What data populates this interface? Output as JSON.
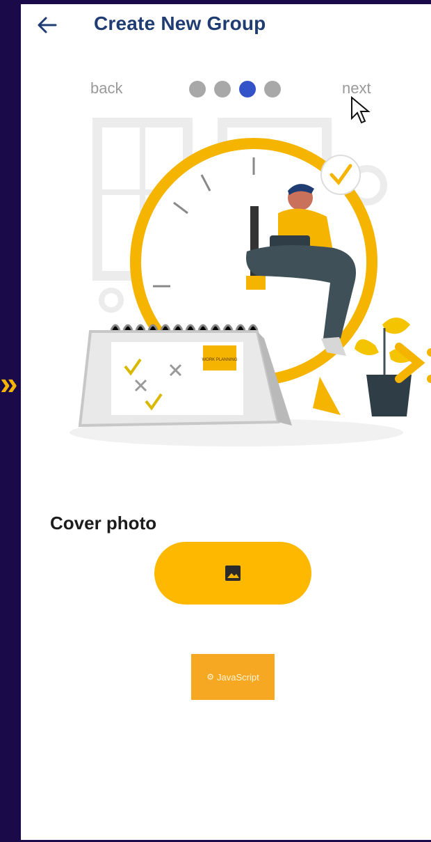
{
  "header": {
    "title": "Create New Group",
    "back_icon": "arrow-left-icon"
  },
  "steps": {
    "back_label": "back",
    "next_label": "next",
    "total": 4,
    "current": 3
  },
  "illustration": {
    "icon": "clock-calendar-illustration",
    "note_text": "WORK PLANNING"
  },
  "cover": {
    "label": "Cover photo",
    "button_icon": "image-icon"
  },
  "thumbnail": {
    "text": "JavaScript",
    "logo_glyph": "⚙"
  },
  "colors": {
    "accent": "#ffb800",
    "title": "#1f3d73",
    "active_dot": "#3553c8",
    "inactive_dot": "#a8a8a8",
    "frame_border": "#1a0a4a"
  }
}
